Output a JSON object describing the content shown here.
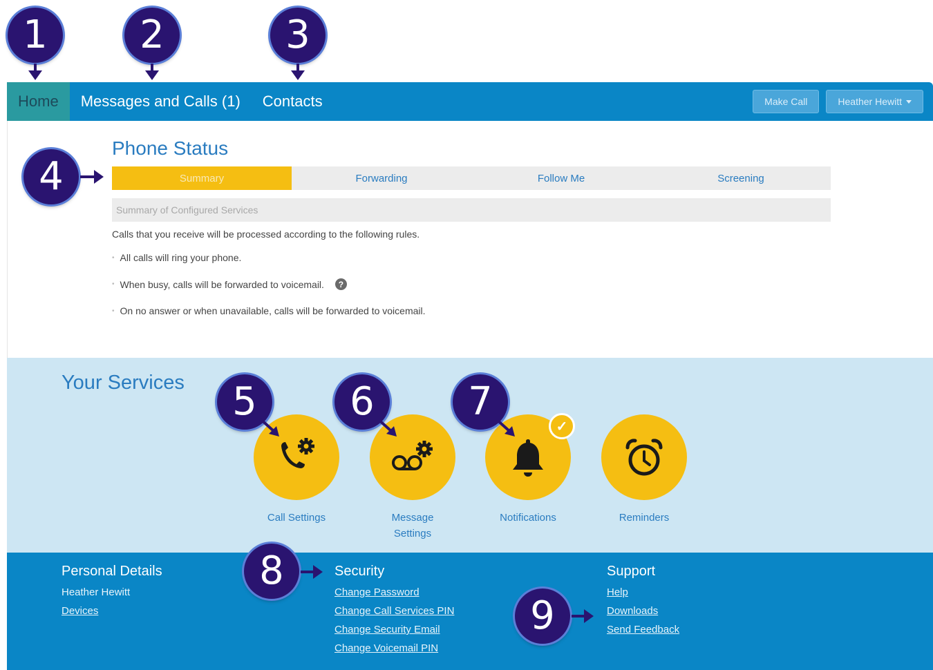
{
  "callouts": [
    "1",
    "2",
    "3",
    "4",
    "5",
    "6",
    "7",
    "8",
    "9"
  ],
  "nav": {
    "items": [
      {
        "label": "Home",
        "active": true
      },
      {
        "label": "Messages and Calls (1)",
        "active": false
      },
      {
        "label": "Contacts",
        "active": false
      }
    ],
    "make_call": "Make Call",
    "user_menu": "Heather Hewitt"
  },
  "phone_status": {
    "title": "Phone Status",
    "tabs": [
      {
        "label": "Summary",
        "active": true
      },
      {
        "label": "Forwarding",
        "active": false
      },
      {
        "label": "Follow Me",
        "active": false
      },
      {
        "label": "Screening",
        "active": false
      }
    ],
    "summary_header": "Summary of Configured Services",
    "intro": "Calls that you receive will be processed according to the following rules.",
    "rules": [
      "All calls will ring your phone.",
      "When busy, calls will be forwarded to voicemail.",
      "On no answer or when unavailable, calls will be forwarded to voicemail."
    ],
    "help_icon": "question-circle-icon"
  },
  "services": {
    "title": "Your Services",
    "items": [
      {
        "label": "Call Settings",
        "icon": "phone-gear-icon"
      },
      {
        "label": "Message Settings",
        "icon": "voicemail-gear-icon"
      },
      {
        "label": "Notifications",
        "icon": "bell-icon",
        "enabled": true
      },
      {
        "label": "Reminders",
        "icon": "alarm-clock-icon"
      }
    ],
    "check_glyph": "✓"
  },
  "footer": {
    "personal": {
      "title": "Personal Details",
      "name": "Heather Hewitt",
      "links": [
        "Devices"
      ]
    },
    "security": {
      "title": "Security",
      "links": [
        "Change Password",
        "Change Call Services PIN",
        "Change Security Email",
        "Change Voicemail PIN"
      ]
    },
    "support": {
      "title": "Support",
      "links": [
        "Help",
        "Downloads",
        "Send Feedback"
      ]
    }
  },
  "colors": {
    "nav_blue": "#0a86c6",
    "accent_yellow": "#f5be12",
    "services_bg": "#cde6f3",
    "callout_purple": "#2a1470",
    "title_blue": "#2a7cc0"
  }
}
